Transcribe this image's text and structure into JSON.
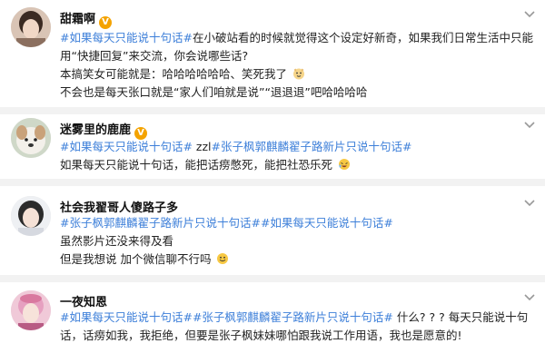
{
  "posts": [
    {
      "user": "甜霜啊",
      "verified": true,
      "lines": [
        {
          "segments": [
            {
              "text": "#如果每天只能说十句话#",
              "tag": true
            },
            {
              "text": "在小破站看的时候就觉得这个设定好新奇，如果我们日常生活中只能"
            }
          ]
        },
        {
          "segments": [
            {
              "text": "用“快捷回复”来交流，你会说哪些话?"
            }
          ]
        },
        {
          "segments": [
            {
              "text": "本搞笑女可能就是：哈哈哈哈哈哈、笑死我了"
            }
          ],
          "emoji": "dog-face-emoji"
        },
        {
          "segments": [
            {
              "text": "不会也是每天张口就是“家人们咱就是说”“退退退”吧哈哈哈哈"
            }
          ]
        }
      ]
    },
    {
      "user": "迷雾里的鹿鹿",
      "verified": true,
      "lines": [
        {
          "segments": [
            {
              "text": "#如果每天只能说十句话#",
              "tag": true
            },
            {
              "text": " zzl"
            },
            {
              "text": "#张子枫郭麒麟翟子路新片只说十句话#",
              "tag": true
            }
          ]
        },
        {
          "segments": [
            {
              "text": "如果每天只能说十句话，能把话痨憋死，能把社恐乐死"
            }
          ],
          "emoji": "laughing-emoji"
        }
      ]
    },
    {
      "user": "社会我翟哥人傻路子多",
      "verified": false,
      "lines": [
        {
          "segments": [
            {
              "text": "#张子枫郭麒麟翟子路新片只说十句话#",
              "tag": true
            },
            {
              "text": "#如果每天只能说十句话#",
              "tag": true
            }
          ]
        },
        {
          "segments": [
            {
              "text": "虽然影片还没来得及看"
            }
          ]
        },
        {
          "segments": [
            {
              "text": "但是我想说 加个微信聊不行吗"
            }
          ],
          "emoji": "smile-emoji"
        }
      ]
    },
    {
      "user": "一夜知恩",
      "verified": false,
      "lines": [
        {
          "segments": [
            {
              "text": "#如果每天只能说十句话#",
              "tag": true
            },
            {
              "text": "#张子枫郭麒麟翟子路新片只说十句话#",
              "tag": true
            },
            {
              "text": " 什么? ? ? 每天只能说十句"
            }
          ]
        },
        {
          "segments": [
            {
              "text": "话，话痨如我，我拒绝，但要是张子枫妹妹哪怕跟我说工作用语，我也是愿意的!"
            }
          ]
        }
      ]
    }
  ],
  "colors": {
    "hashtag": "#3d7fd9",
    "verified_badge": "#f4a300",
    "divider": "#f2f2f2"
  }
}
